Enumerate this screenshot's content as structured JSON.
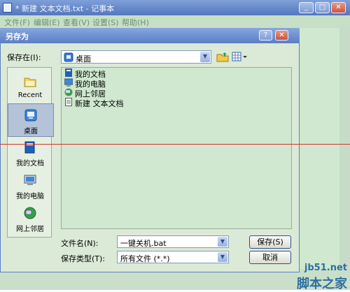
{
  "notepad": {
    "title": "* 新建 文本文档.txt - 记事本",
    "menu": [
      "文件(F)",
      "编辑(E)",
      "查看(V)",
      "设置(S)",
      "帮助(H)"
    ],
    "controls": {
      "minimize": "_",
      "maximize": "□",
      "close": "✕"
    }
  },
  "dialog": {
    "title": "另存为",
    "help": "?",
    "close": "✕",
    "save_in_label": "保存在(I):",
    "save_in_value": "桌面",
    "places": [
      {
        "label": "Recent",
        "icon": "recent-folder-icon"
      },
      {
        "label": "桌面",
        "icon": "desktop-icon",
        "selected": true
      },
      {
        "label": "我的文档",
        "icon": "my-documents-icon"
      },
      {
        "label": "我的电脑",
        "icon": "my-computer-icon"
      },
      {
        "label": "网上邻居",
        "icon": "network-places-icon"
      }
    ],
    "files": [
      {
        "label": "我的文档",
        "icon": "my-documents-icon"
      },
      {
        "label": "我的电脑",
        "icon": "my-computer-icon"
      },
      {
        "label": "网上邻居",
        "icon": "network-places-icon"
      },
      {
        "label": "新建 文本文档",
        "icon": "text-file-icon"
      }
    ],
    "filename_label": "文件名(N):",
    "filename_value": "一键关机.bat",
    "filetype_label": "保存类型(T):",
    "filetype_value": "所有文件 (*.*)",
    "save_button": "保存(S)",
    "cancel_button": "取消"
  },
  "watermark": {
    "site": "jb51.net",
    "name": "脚本之家"
  }
}
